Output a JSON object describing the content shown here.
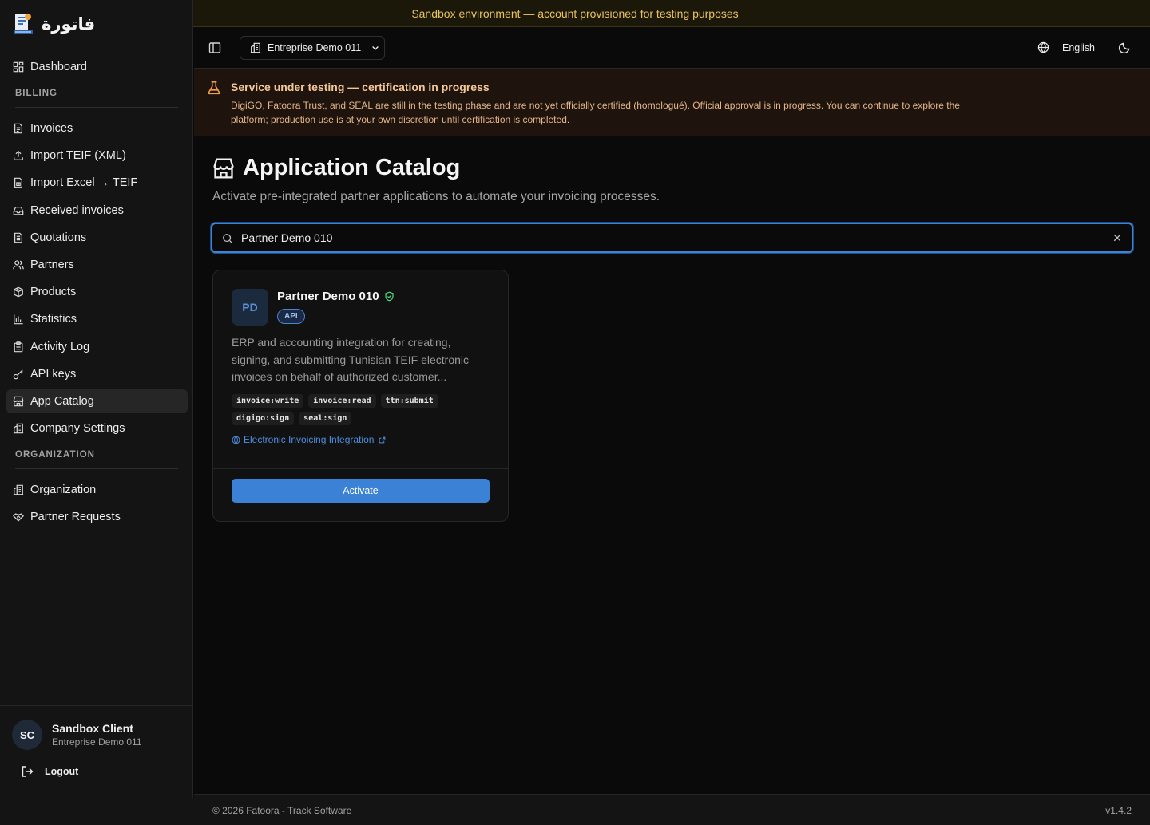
{
  "banner": {
    "text": "Sandbox environment — account provisioned for testing purposes"
  },
  "brand": {
    "name": "فاتورة",
    "logo_icon": "invoice-logo-icon"
  },
  "sidebar": {
    "items": [
      {
        "label": "Dashboard",
        "icon": "dashboard-icon"
      },
      {
        "label": "Invoices",
        "icon": "file-icon"
      },
      {
        "label": "Import TEIF (XML)",
        "icon": "upload-icon"
      },
      {
        "label": "Import Excel → TEIF",
        "icon": "spreadsheet-icon"
      },
      {
        "label": "Received invoices",
        "icon": "inbox-icon"
      },
      {
        "label": "Quotations",
        "icon": "document-icon"
      },
      {
        "label": "Partners",
        "icon": "users-icon"
      },
      {
        "label": "Products",
        "icon": "package-icon"
      },
      {
        "label": "Statistics",
        "icon": "bar-chart-icon"
      },
      {
        "label": "Activity Log",
        "icon": "clipboard-icon"
      },
      {
        "label": "API keys",
        "icon": "key-icon"
      },
      {
        "label": "App Catalog",
        "icon": "store-icon"
      },
      {
        "label": "Company Settings",
        "icon": "building-icon"
      },
      {
        "label": "Organization",
        "icon": "building-icon"
      },
      {
        "label": "Partner Requests",
        "icon": "handshake-icon"
      }
    ],
    "sections": {
      "billing": "BILLING",
      "organization": "ORGANIZATION"
    },
    "active": "App Catalog"
  },
  "user": {
    "initials": "SC",
    "name": "Sandbox Client",
    "org": "Entreprise Demo 011",
    "logout_label": "Logout"
  },
  "header": {
    "org_name": "Entreprise Demo 011",
    "language": "English"
  },
  "notice": {
    "title": "Service under testing — certification in progress",
    "body": "DigiGO, Fatoora Trust, and SEAL are still in the testing phase and are not yet officially certified (homologué). Official approval is in progress. You can continue to explore the platform; production use is at your own discretion until certification is completed."
  },
  "main": {
    "title": "Application Catalog",
    "subtitle": "Activate pre-integrated partner applications to automate your invoicing processes.",
    "search_value": "Partner Demo 010"
  },
  "card": {
    "initials": "PD",
    "name": "Partner Demo 010",
    "badge": "API",
    "description": "ERP and accounting integration for creating, signing, and submitting Tunisian TEIF electronic invoices on behalf of authorized customer...",
    "scopes": [
      "invoice:write",
      "invoice:read",
      "ttn:submit",
      "digigo:sign",
      "seal:sign"
    ],
    "link": "Electronic Invoicing Integration",
    "action": "Activate"
  },
  "footer": {
    "copyright": "© 2026 Fatoora - Track Software",
    "version": "v1.4.2"
  },
  "colors": {
    "accent": "#3b82d6",
    "warning": "#f59e4b",
    "banner": "#e8c35c",
    "verified": "#4ade80"
  }
}
